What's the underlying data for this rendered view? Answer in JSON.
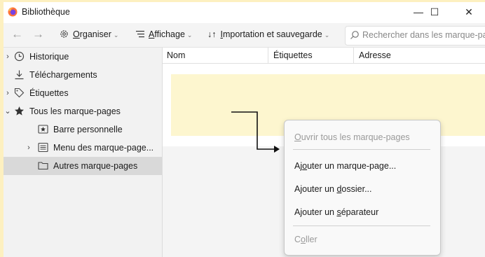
{
  "window": {
    "title": "Bibliothèque",
    "minimize": "—",
    "maximize": "☐",
    "close": "✕"
  },
  "toolbar": {
    "organiser_key": "O",
    "organiser_rest": "rganiser",
    "affichage_key": "A",
    "affichage_rest": "ffichage",
    "import_key": "I",
    "import_rest": "mportation et sauvegarde",
    "search_placeholder": "Rechercher dans les marque-pages"
  },
  "sidebar": {
    "items": [
      {
        "label": "Historique",
        "icon": "clock-icon",
        "twisty": "›"
      },
      {
        "label": "Téléchargements",
        "icon": "download-icon",
        "twisty": ""
      },
      {
        "label": "Étiquettes",
        "icon": "tag-icon",
        "twisty": "›"
      },
      {
        "label": "Tous les marque-pages",
        "icon": "star-icon",
        "twisty": "⌄"
      },
      {
        "label": "Barre personnelle",
        "icon": "toolbar-star-icon",
        "twisty": ""
      },
      {
        "label": "Menu des marque-page...",
        "icon": "menu-list-icon",
        "twisty": "›"
      },
      {
        "label": "Autres marque-pages",
        "icon": "folder-icon",
        "twisty": ""
      }
    ]
  },
  "columns": {
    "name": "Nom",
    "tags": "Étiquettes",
    "address": "Adresse"
  },
  "context_menu": {
    "open_all_pre": "",
    "open_all_key": "O",
    "open_all_rest": "uvrir tous les marque-pages",
    "add_bookmark_pre": "Aj",
    "add_bookmark_key": "o",
    "add_bookmark_rest": "uter un marque-page...",
    "add_folder_pre": "Ajouter un ",
    "add_folder_key": "d",
    "add_folder_rest": "ossier...",
    "add_separator_pre": "Ajouter un ",
    "add_separator_key": "s",
    "add_separator_rest": "éparateur",
    "paste_pre": "C",
    "paste_key": "o",
    "paste_rest": "ller"
  },
  "colors": {
    "background": "#fdf0c0",
    "highlight": "#fdf6cf",
    "selected": "#d9d9d9"
  }
}
